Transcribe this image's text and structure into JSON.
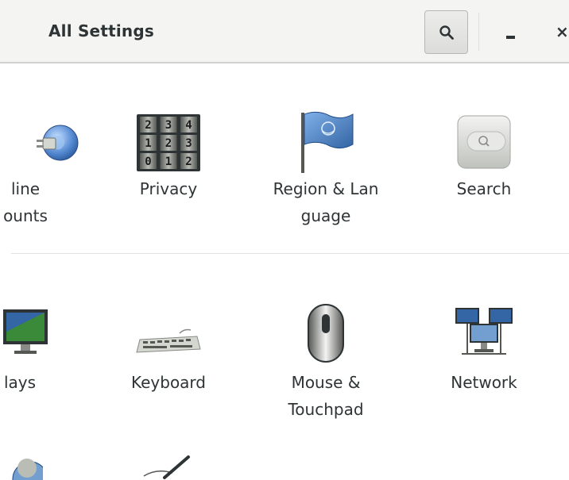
{
  "window": {
    "title": "All Settings",
    "search_icon": "search-icon",
    "minimize_icon": "minimize-icon",
    "close_label": "×"
  },
  "rows": [
    {
      "items": [
        {
          "id": "online-accounts",
          "label_line1": "line",
          "label_line2": "ounts",
          "icon": "globe-plug-icon"
        },
        {
          "id": "privacy",
          "label_line1": "Privacy",
          "label_line2": "",
          "icon": "combination-lock-icon"
        },
        {
          "id": "region-language",
          "label_line1": "Region & Lan",
          "label_line2": "guage",
          "icon": "flag-icon"
        },
        {
          "id": "search",
          "label_line1": "Search",
          "label_line2": "",
          "icon": "search-panel-icon"
        }
      ]
    },
    {
      "items": [
        {
          "id": "displays",
          "label_line1": "lays",
          "label_line2": "",
          "icon": "monitor-icon"
        },
        {
          "id": "keyboard",
          "label_line1": "Keyboard",
          "label_line2": "",
          "icon": "keyboard-icon"
        },
        {
          "id": "mouse-touchpad",
          "label_line1": "Mouse &",
          "label_line2": "Touchpad",
          "icon": "mouse-icon"
        },
        {
          "id": "network",
          "label_line1": "Network",
          "label_line2": "",
          "icon": "network-icon"
        }
      ]
    }
  ],
  "lock_digits": [
    "2",
    "3",
    "4",
    "1",
    "2",
    "3",
    "0",
    "1",
    "2"
  ]
}
